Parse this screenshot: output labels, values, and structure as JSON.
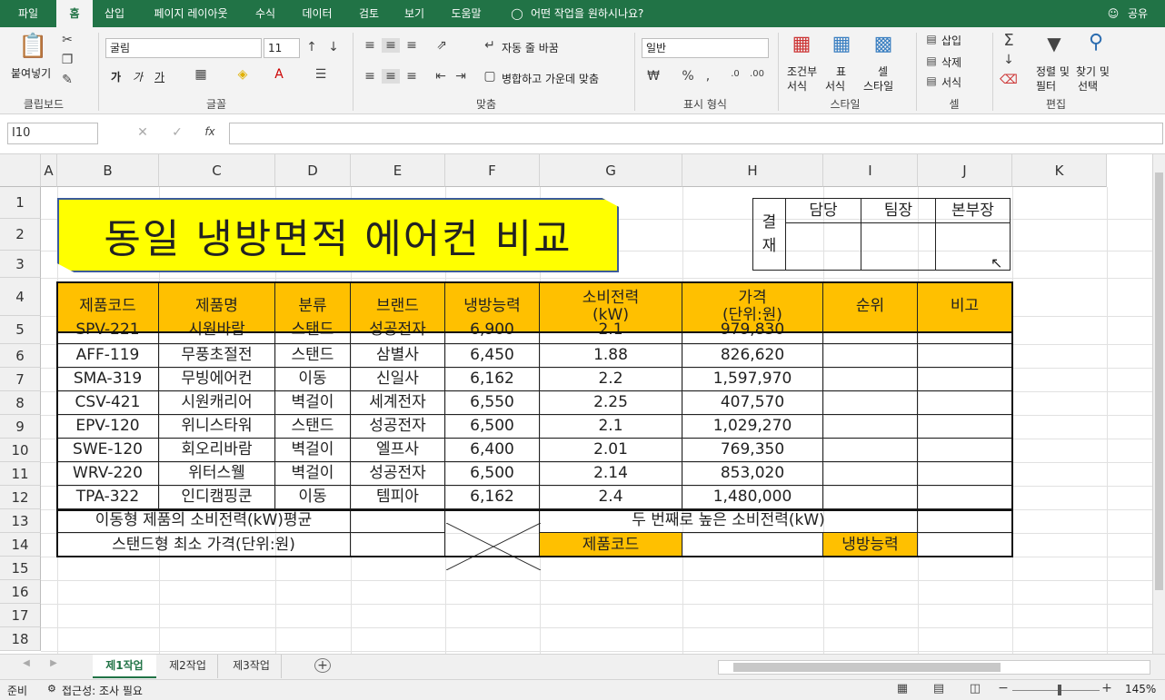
{
  "tabs": [
    "파일",
    "홈",
    "삽입",
    "페이지 레이아웃",
    "수식",
    "데이터",
    "검토",
    "보기",
    "도움말"
  ],
  "tell_me": "어떤 작업을 원하시나요?",
  "share": "공유",
  "ribbon": {
    "clipboard": {
      "paste": "붙여넣기",
      "label": "클립보드"
    },
    "font": {
      "name": "굴림",
      "size": "11",
      "bold": "가",
      "italic": "가",
      "underline": "가",
      "label": "글꼴"
    },
    "align": {
      "wrap": "자동 줄 바꿈",
      "merge": "병합하고 가운데 맞춤",
      "label": "맞춤"
    },
    "number": {
      "format": "일반",
      "label": "표시 형식"
    },
    "styles": {
      "cond1": "조건부",
      "cond2": "서식",
      "table1": "표",
      "table2": "서식",
      "cell1": "셀",
      "cell2": "스타일",
      "label": "스타일"
    },
    "cells": {
      "insert": "삽입",
      "delete": "삭제",
      "format": "서식",
      "label": "셀"
    },
    "edit": {
      "sort1": "정렬 및",
      "sort2": "필터",
      "find1": "찾기 및",
      "find2": "선택",
      "label": "편집"
    }
  },
  "formula": {
    "namebox": "I10",
    "fx": "fx",
    "value": ""
  },
  "columns": [
    "A",
    "B",
    "C",
    "D",
    "E",
    "F",
    "G",
    "H",
    "I",
    "J",
    "K"
  ],
  "rows": [
    "1",
    "2",
    "3",
    "4",
    "5",
    "6",
    "7",
    "8",
    "9",
    "10",
    "11",
    "12",
    "13",
    "14",
    "15",
    "16",
    "17",
    "18"
  ],
  "sheet": {
    "title": "동일 냉방면적 에어컨 비교",
    "approval": {
      "label1": "결",
      "label2": "재",
      "h1": "담당",
      "h2": "팀장",
      "h3": "본부장"
    },
    "headers": [
      "제품코드",
      "제품명",
      "분류",
      "브랜드",
      "냉방능력",
      "소비전력\n(kW)",
      "가격\n(단위:원)",
      "순위",
      "비고"
    ],
    "data": [
      [
        "SPV-221",
        "시원바람",
        "스탠드",
        "성공전자",
        "6,900",
        "2.1",
        "979,830"
      ],
      [
        "AFF-119",
        "무풍초절전",
        "스탠드",
        "삼별사",
        "6,450",
        "1.88",
        "826,620"
      ],
      [
        "SMA-319",
        "무빙에어컨",
        "이동",
        "신일사",
        "6,162",
        "2.2",
        "1,597,970"
      ],
      [
        "CSV-421",
        "시원캐리어",
        "벽걸이",
        "세계전자",
        "6,550",
        "2.25",
        "407,570"
      ],
      [
        "EPV-120",
        "위니스타워",
        "스탠드",
        "성공전자",
        "6,500",
        "2.1",
        "1,029,270"
      ],
      [
        "SWE-120",
        "회오리바람",
        "벽걸이",
        "엘프사",
        "6,400",
        "2.01",
        "769,350"
      ],
      [
        "WRV-220",
        "위터스웰",
        "벽걸이",
        "성공전자",
        "6,500",
        "2.14",
        "853,020"
      ],
      [
        "TPA-322",
        "인디캠핑쿤",
        "이동",
        "템피아",
        "6,162",
        "2.4",
        "1,480,000"
      ]
    ],
    "r13a": "이동형 제품의 소비전력(kW)평균",
    "r13b": "두 번째로 높은 소비전력(kW)",
    "r14a": "스탠드형 최소 가격(단위:원)",
    "r14b": "제품코드",
    "r14c": "냉방능력"
  },
  "sheet_tabs": [
    "제1작업",
    "제2작업",
    "제3작업"
  ],
  "status": {
    "ready": "준비",
    "access": "접근성: 조사 필요",
    "zoom": "145%"
  },
  "colors": {
    "excel_green": "#217346",
    "header_fill": "#ffc000",
    "title_fill": "#ffff00"
  }
}
